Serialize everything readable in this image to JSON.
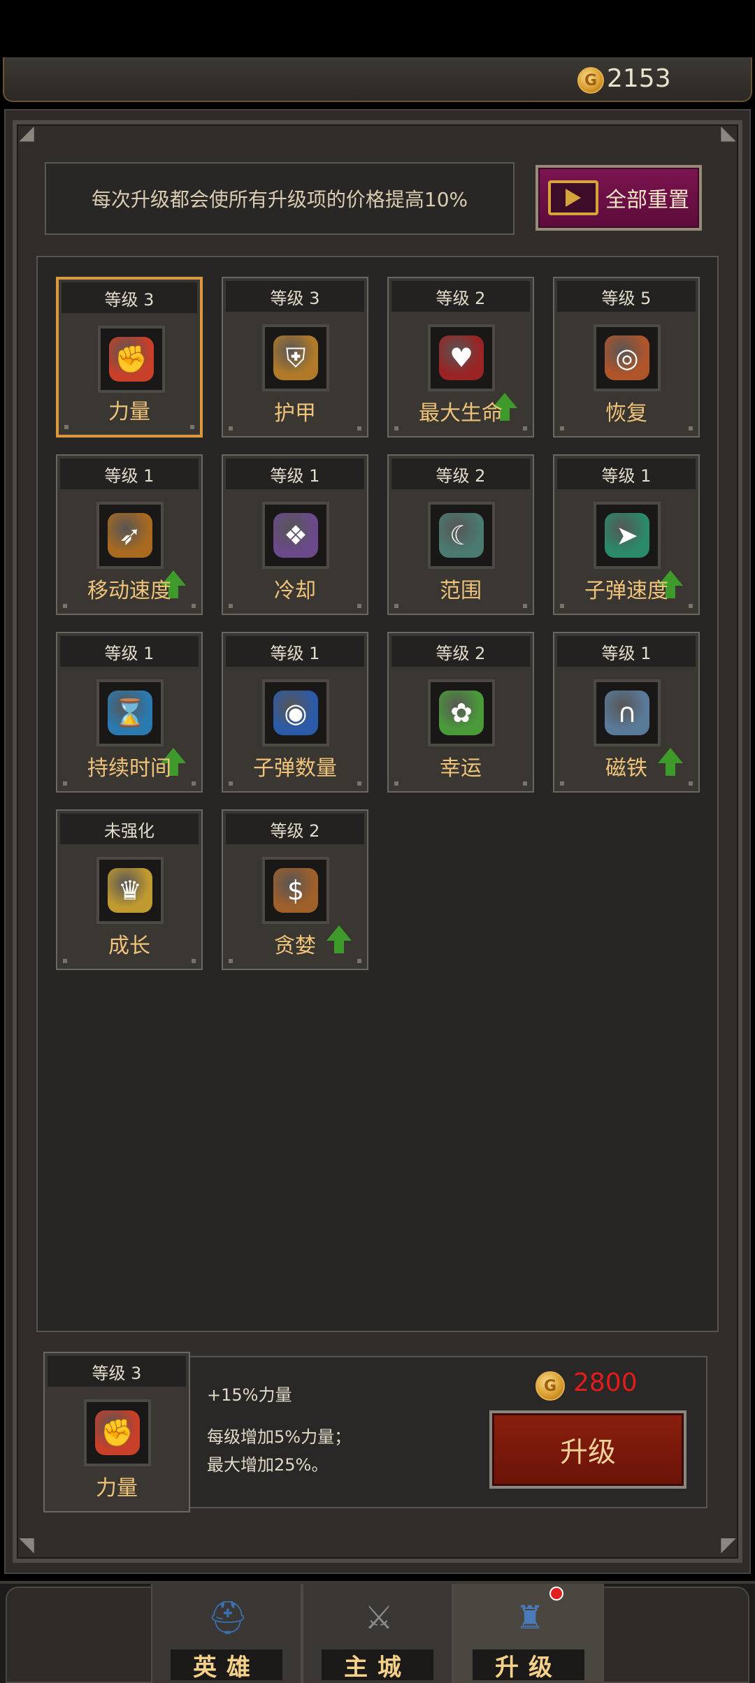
{
  "header": {
    "gold": "2153",
    "coin_glyph": "G"
  },
  "notice": {
    "text": "每次升级都会使所有升级项的价格提高10%"
  },
  "reset_button": {
    "label": "全部重置",
    "icon": "video-play-icon"
  },
  "upgrades": [
    {
      "level": "等级 3",
      "name": "力量",
      "icon": "strength-bracer-icon",
      "glyph": "✊",
      "color": "#c8402a",
      "upgradable": false,
      "selected": true
    },
    {
      "level": "等级 3",
      "name": "护甲",
      "icon": "armor-icon",
      "glyph": "⛨",
      "color": "#b07a28",
      "upgradable": false,
      "selected": false
    },
    {
      "level": "等级 2",
      "name": "最大生命",
      "icon": "helmet-icon",
      "glyph": "♥",
      "color": "#9a2424",
      "upgradable": true,
      "selected": false
    },
    {
      "level": "等级 5",
      "name": "恢复",
      "icon": "ring-icon",
      "glyph": "◎",
      "color": "#b0552a",
      "upgradable": false,
      "selected": false
    },
    {
      "level": "等级 1",
      "name": "移动速度",
      "icon": "boots-icon",
      "glyph": "➶",
      "color": "#a86a20",
      "upgradable": true,
      "selected": false
    },
    {
      "level": "等级 1",
      "name": "冷却",
      "icon": "spellbook-icon",
      "glyph": "❖",
      "color": "#6a4a8a",
      "upgradable": false,
      "selected": false
    },
    {
      "level": "等级 2",
      "name": "范围",
      "icon": "amulet-icon",
      "glyph": "☾",
      "color": "#4a7a70",
      "upgradable": false,
      "selected": false
    },
    {
      "level": "等级 1",
      "name": "子弹速度",
      "icon": "gauntlet-icon",
      "glyph": "➤",
      "color": "#2a8a6a",
      "upgradable": true,
      "selected": false
    },
    {
      "level": "等级 1",
      "name": "持续时间",
      "icon": "hood-icon",
      "glyph": "⌛",
      "color": "#2a7ab0",
      "upgradable": true,
      "selected": false
    },
    {
      "level": "等级 1",
      "name": "子弹数量",
      "icon": "blue-ring-icon",
      "glyph": "◉",
      "color": "#2a5aa8",
      "upgradable": false,
      "selected": false
    },
    {
      "level": "等级 2",
      "name": "幸运",
      "icon": "clover-flower-icon",
      "glyph": "✿",
      "color": "#4a9a3a",
      "upgradable": false,
      "selected": false
    },
    {
      "level": "等级 1",
      "name": "磁铁",
      "icon": "magnet-helm-icon",
      "glyph": "∩",
      "color": "#5a7a9a",
      "upgradable": true,
      "selected": false
    },
    {
      "level": "未强化",
      "name": "成长",
      "icon": "crown-icon",
      "glyph": "♛",
      "color": "#c09a30",
      "upgradable": false,
      "selected": false
    },
    {
      "level": "等级 2",
      "name": "贪婪",
      "icon": "money-bag-icon",
      "glyph": "$",
      "color": "#a0602a",
      "upgradable": true,
      "selected": false
    }
  ],
  "detail": {
    "level": "等级 3",
    "name": "力量",
    "icon": "strength-bracer-icon",
    "glyph": "✊",
    "color": "#c8402a",
    "title": "+15%力量",
    "desc_line1": "每级增加5%力量；",
    "desc_line2": "最大增加25%。",
    "cost": "2800",
    "upgrade_label": "升级"
  },
  "nav": [
    {
      "label": "英雄",
      "icon": "hero-helmet-icon",
      "glyph": "⛑",
      "color": "#3a70b0",
      "active": false
    },
    {
      "label": "主城",
      "icon": "crossed-swords-icon",
      "glyph": "⚔",
      "color": "#8a8a8a",
      "active": false
    },
    {
      "label": "升级",
      "icon": "upgrade-castle-icon",
      "glyph": "♜",
      "color": "#4a7ab8",
      "active": true,
      "badge": true
    }
  ]
}
